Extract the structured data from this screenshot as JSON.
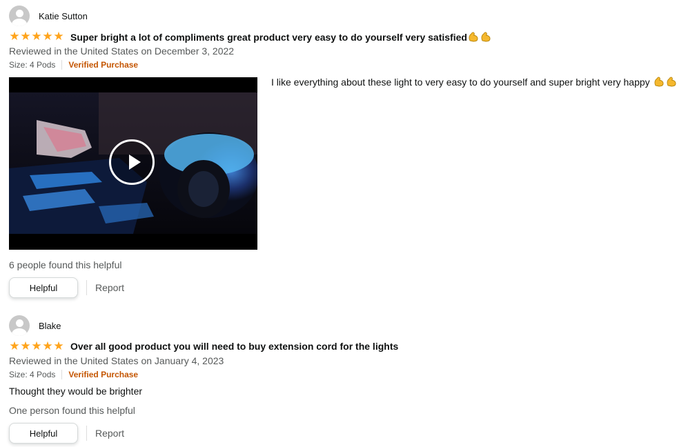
{
  "reviews": [
    {
      "profile_name": "Katie Sutton",
      "rating": 5,
      "title": "Super bright a lot of compliments great product very easy to do yourself very satisfied",
      "title_emoji": "flexed-biceps x2",
      "date": "Reviewed in the United States on December 3, 2022",
      "size": "Size: 4 Pods",
      "verified": "Verified Purchase",
      "body": "I like everything about these light to very easy to do yourself and super bright very happy",
      "body_emoji": "flexed-biceps x2",
      "has_video": true,
      "helpful_count": "6 people found this helpful",
      "helpful_label": "Helpful",
      "report_label": "Report"
    },
    {
      "profile_name": "Blake",
      "rating": 5,
      "title": "Over all good product you will need to buy extension cord for the lights",
      "date": "Reviewed in the United States on January 4, 2023",
      "size": "Size: 4 Pods",
      "verified": "Verified Purchase",
      "body": "Thought they would be brighter",
      "helpful_count": "One person found this helpful",
      "helpful_label": "Helpful",
      "report_label": "Report"
    }
  ],
  "colors": {
    "star": "#ffa41c",
    "verified": "#c45500",
    "muted": "#565959",
    "text": "#0f1111"
  }
}
